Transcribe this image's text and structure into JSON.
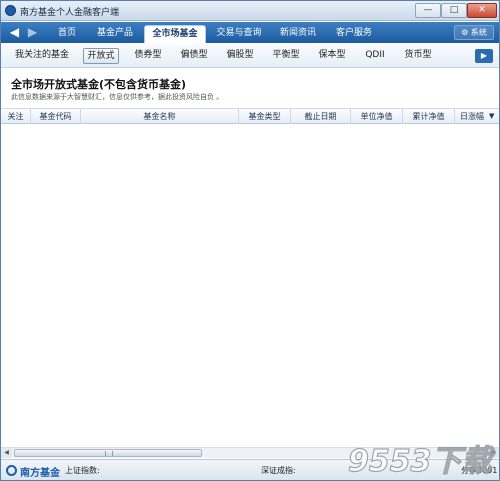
{
  "window": {
    "title": "南方基金个人金融客户端",
    "min_glyph": "—",
    "max_glyph": "□",
    "close_glyph": "✕"
  },
  "nav": {
    "back_icon": "arrow-left-icon",
    "back_glyph": "◀",
    "forward_glyph": "▶",
    "tabs": [
      {
        "label": "首页"
      },
      {
        "label": "基金产品"
      },
      {
        "label": "全市场基金"
      },
      {
        "label": "交易与查询"
      },
      {
        "label": "新闻资讯"
      },
      {
        "label": "客户服务"
      }
    ],
    "active_tab": "全市场基金",
    "system_label": "⚙ 系统"
  },
  "subtabs": {
    "items": [
      {
        "label": "我关注的基金"
      },
      {
        "label": "开放式"
      },
      {
        "label": "债券型"
      },
      {
        "label": "偏债型"
      },
      {
        "label": "偏股型"
      },
      {
        "label": "平衡型"
      },
      {
        "label": "保本型"
      },
      {
        "label": "QDII"
      },
      {
        "label": "货币型"
      }
    ],
    "active": "开放式",
    "next_glyph": "▶"
  },
  "main": {
    "title": "全市场开放式基金(不包含货币基金)",
    "disclaimer": "此信息数据来源于大智慧财汇，信息仅供参考，据此投资风险自负 。"
  },
  "table": {
    "columns": [
      {
        "label": "关注"
      },
      {
        "label": "基金代码"
      },
      {
        "label": "基金名称"
      },
      {
        "label": "基金类型"
      },
      {
        "label": "截止日期"
      },
      {
        "label": "单位净值"
      },
      {
        "label": "累计净值"
      },
      {
        "label": "日涨幅"
      }
    ],
    "sort_glyph": "▼",
    "rows": []
  },
  "scrollbar": {
    "left_glyph": "◀",
    "right_glyph": "▶"
  },
  "status": {
    "brand": "南方基金",
    "sh_label": "上证指数:",
    "sz_label": "深证成指:",
    "right_text": "分享3001"
  },
  "watermark": {
    "text": "9553下载"
  },
  "colors": {
    "nav_blue": "#1c5a9f",
    "brand_blue": "#1b5ea8",
    "close_red": "#c84a33"
  }
}
